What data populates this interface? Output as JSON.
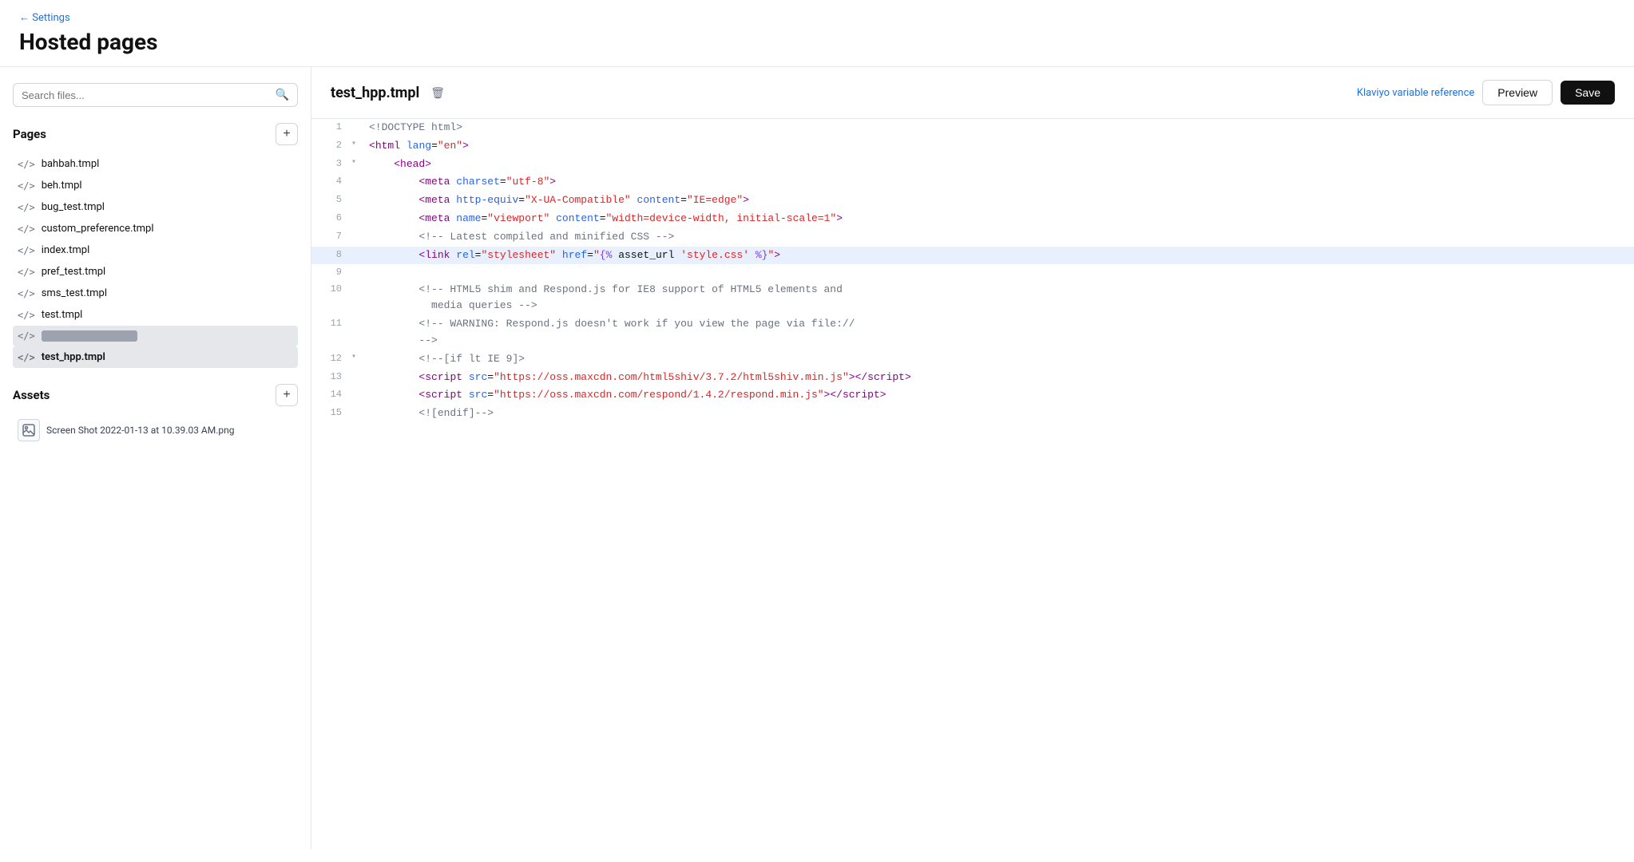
{
  "header": {
    "back_label": "← Settings",
    "page_title": "Hosted pages"
  },
  "sidebar": {
    "search_placeholder": "Search files...",
    "pages_section_label": "Pages",
    "add_page_label": "+",
    "files": [
      {
        "id": "bahbah",
        "name": "bahbah.tmpl",
        "active": false
      },
      {
        "id": "beh",
        "name": "beh.tmpl",
        "active": false
      },
      {
        "id": "bug_test",
        "name": "bug_test.tmpl",
        "active": false
      },
      {
        "id": "custom_preference",
        "name": "custom_preference.tmpl",
        "active": false
      },
      {
        "id": "index",
        "name": "index.tmpl",
        "active": false
      },
      {
        "id": "pref_test",
        "name": "pref_test.tmpl",
        "active": false
      },
      {
        "id": "sms_test",
        "name": "sms_test.tmpl",
        "active": false
      },
      {
        "id": "test",
        "name": "test.tmpl",
        "active": false
      },
      {
        "id": "redacted",
        "name": "",
        "active": false,
        "redacted": true
      },
      {
        "id": "test_hpp",
        "name": "test_hpp.tmpl",
        "active": true
      }
    ],
    "assets_section_label": "Assets",
    "add_asset_label": "+",
    "assets": [
      {
        "id": "screenshot",
        "name": "Screen Shot 2022-01-13 at 10.39.03 AM.png"
      }
    ]
  },
  "editor": {
    "filename": "test_hpp.tmpl",
    "var_ref_label": "Klaviyo variable reference",
    "preview_label": "Preview",
    "save_label": "Save",
    "lines": [
      {
        "num": 1,
        "fold": "",
        "highlighted": false,
        "html": "<span class='c-comment'>&lt;!DOCTYPE html&gt;</span>"
      },
      {
        "num": 2,
        "fold": "▾",
        "highlighted": false,
        "html": "<span class='c-bracket'>&lt;</span><span class='c-tag'>html</span> <span class='c-attr'>lang</span><span class='c-text'>=</span><span class='c-val'>\"en\"</span><span class='c-bracket'>&gt;</span>"
      },
      {
        "num": 3,
        "fold": "▾",
        "highlighted": false,
        "html": "    <span class='c-bracket'>&lt;</span><span class='c-tag'>head</span><span class='c-bracket'>&gt;</span>"
      },
      {
        "num": 4,
        "fold": "",
        "highlighted": false,
        "html": "        <span class='c-bracket'>&lt;</span><span class='c-tag'>meta</span> <span class='c-attr'>charset</span><span class='c-text'>=</span><span class='c-val'>\"utf-8\"</span><span class='c-bracket'>&gt;</span>"
      },
      {
        "num": 5,
        "fold": "",
        "highlighted": false,
        "html": "        <span class='c-bracket'>&lt;</span><span class='c-tag'>meta</span> <span class='c-attr'>http-equiv</span><span class='c-text'>=</span><span class='c-val'>\"X-UA-Compatible\"</span> <span class='c-attr'>content</span><span class='c-text'>=</span><span class='c-val'>\"IE=edge\"</span><span class='c-bracket'>&gt;</span>"
      },
      {
        "num": 6,
        "fold": "",
        "highlighted": false,
        "html": "        <span class='c-bracket'>&lt;</span><span class='c-tag'>meta</span> <span class='c-attr'>name</span><span class='c-text'>=</span><span class='c-val'>\"viewport\"</span> <span class='c-attr'>content</span><span class='c-text'>=</span><span class='c-val'>\"width=device-width, initial-scale=1\"</span><span class='c-bracket'>&gt;</span>"
      },
      {
        "num": 7,
        "fold": "",
        "highlighted": false,
        "html": "        <span class='c-comment'>&lt;!-- Latest compiled and minified CSS --&gt;</span>"
      },
      {
        "num": 8,
        "fold": "",
        "highlighted": true,
        "html": "        <span class='c-bracket'>&lt;</span><span class='c-tag'>link</span> <span class='c-attr'>rel</span><span class='c-text'>=</span><span class='c-val'>\"stylesheet\"</span> <span class='c-attr'>href</span><span class='c-text'>=</span><span class='c-val'>\"</span><span class='c-template'>{%</span> <span class='c-text'>asset_url</span> <span class='c-val'>'style.css'</span> <span class='c-template'>%}</span><span class='c-val'>\"</span><span class='c-bracket'>&gt;</span>"
      },
      {
        "num": 9,
        "fold": "",
        "highlighted": false,
        "html": ""
      },
      {
        "num": 10,
        "fold": "",
        "highlighted": false,
        "html": "        <span class='c-comment'>&lt;!-- HTML5 shim and Respond.js for IE8 support of HTML5 elements and</span>\n        <span class='c-comment'>  media queries --&gt;</span>"
      },
      {
        "num": 11,
        "fold": "",
        "highlighted": false,
        "html": "        <span class='c-comment'>&lt;!-- WARNING: Respond.js doesn't work if you view the page via file://</span>\n        <span class='c-comment'>--&gt;</span>"
      },
      {
        "num": 12,
        "fold": "▾",
        "highlighted": false,
        "html": "        <span class='c-comment'>&lt;!--[if lt IE 9]&gt;</span>"
      },
      {
        "num": 13,
        "fold": "",
        "highlighted": false,
        "html": "        <span class='c-bracket'>&lt;</span><span class='c-tag'>script</span> <span class='c-attr'>src</span><span class='c-text'>=</span><span class='c-val'>\"https://oss.maxcdn.com/html5shiv/3.7.2/html5shiv.min.js\"</span><span class='c-bracket'>&gt;&lt;/</span><span class='c-tag'>script</span><span class='c-bracket'>&gt;</span>"
      },
      {
        "num": 14,
        "fold": "",
        "highlighted": false,
        "html": "        <span class='c-bracket'>&lt;</span><span class='c-tag'>script</span> <span class='c-attr'>src</span><span class='c-text'>=</span><span class='c-val'>\"https://oss.maxcdn.com/respond/1.4.2/respond.min.js\"</span><span class='c-bracket'>&gt;&lt;/</span><span class='c-tag'>script</span><span class='c-bracket'>&gt;</span>"
      },
      {
        "num": 15,
        "fold": "",
        "highlighted": false,
        "html": "        <span class='c-comment'>&lt;![endif]--&gt;</span>"
      }
    ]
  }
}
